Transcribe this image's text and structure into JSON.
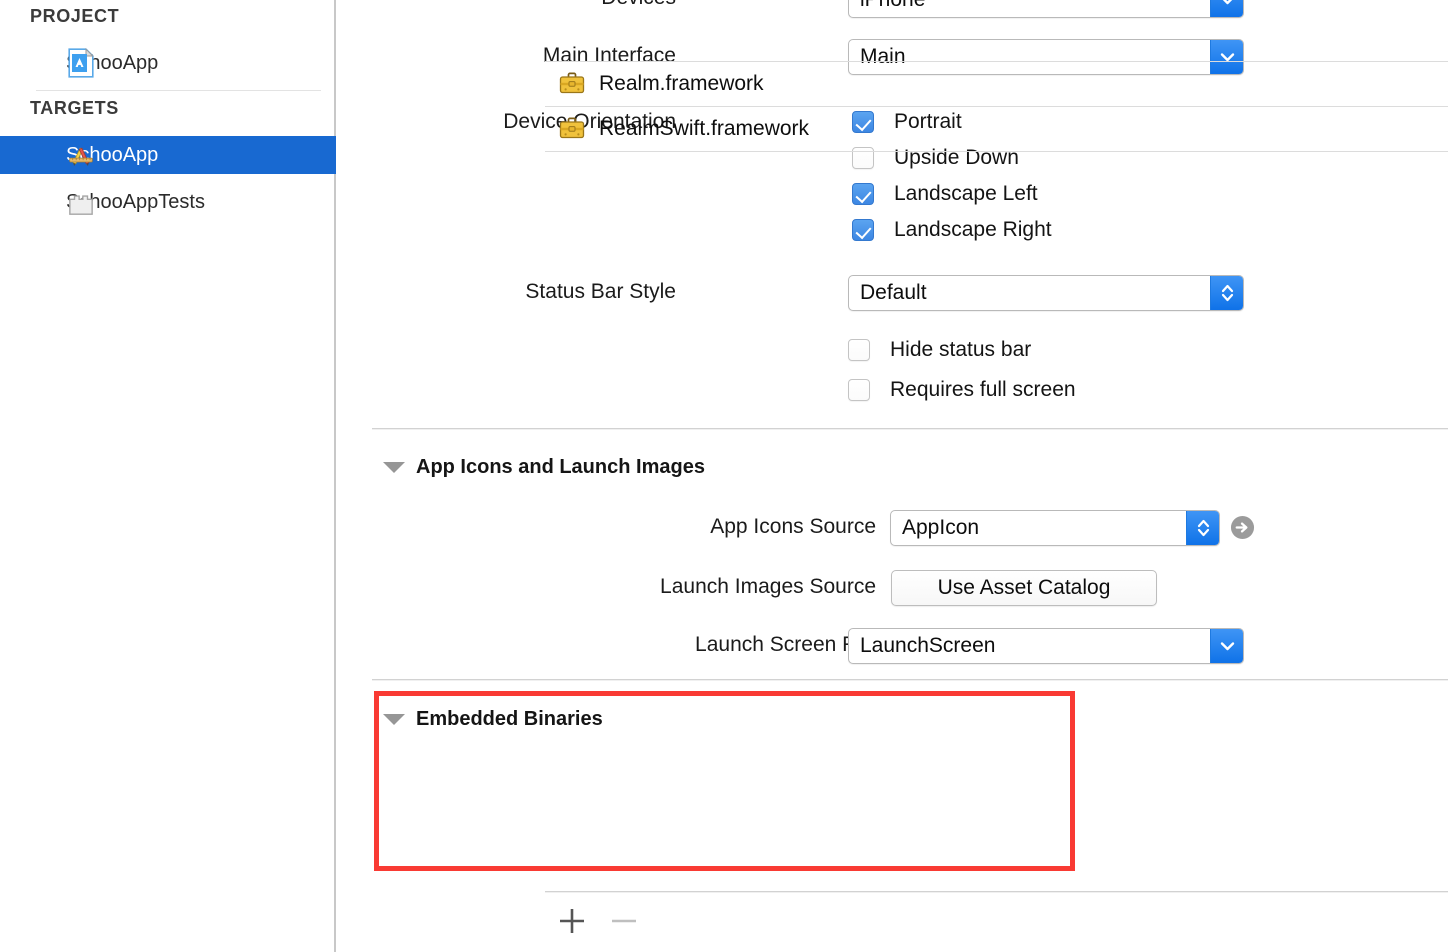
{
  "sidebar": {
    "project_group_label": "PROJECT",
    "targets_group_label": "TARGETS",
    "project_item": {
      "label": "SchooApp",
      "icon": "xcode-project-document-icon"
    },
    "targets": [
      {
        "label": "SchooApp",
        "icon": "xcode-app-target-icon",
        "selected": true
      },
      {
        "label": "SchooAppTests",
        "icon": "xcode-test-bundle-icon",
        "selected": false
      }
    ],
    "selection_color": "#1869d1"
  },
  "deployment_info": {
    "devices": {
      "label": "Devices",
      "value": "iPhone"
    },
    "main_interface": {
      "label": "Main Interface",
      "value": "Main"
    },
    "device_orientation": {
      "label": "Device Orientation",
      "options": [
        {
          "label": "Portrait",
          "checked": true
        },
        {
          "label": "Upside Down",
          "checked": false
        },
        {
          "label": "Landscape Left",
          "checked": true
        },
        {
          "label": "Landscape Right",
          "checked": true
        }
      ]
    },
    "status_bar_style": {
      "label": "Status Bar Style",
      "value": "Default"
    },
    "hide_status_bar": {
      "label": "Hide status bar",
      "checked": false
    },
    "requires_full_screen": {
      "label": "Requires full screen",
      "checked": false
    }
  },
  "app_icons_section": {
    "title": "App Icons and Launch Images",
    "app_icons_source": {
      "label": "App Icons Source",
      "value": "AppIcon",
      "goto_icon": "arrow-right-circle-icon"
    },
    "launch_images_source": {
      "label": "Launch Images Source",
      "button_label": "Use Asset Catalog"
    },
    "launch_screen_file": {
      "label": "Launch Screen File",
      "value": "LaunchScreen"
    }
  },
  "embedded_binaries_section": {
    "title": "Embedded Binaries",
    "highlight_color": "#f93a33",
    "items": [
      {
        "name": "Realm.framework",
        "icon": "framework-briefcase-icon"
      },
      {
        "name": "RealmSwift.framework",
        "icon": "framework-briefcase-icon"
      }
    ],
    "add_button_label": "+",
    "remove_button_label": "–"
  },
  "theme": {
    "control_blue": "#1f7ae0",
    "checkbox_blue": "#4a90e8",
    "separator_gray": "#d2d2d2"
  }
}
